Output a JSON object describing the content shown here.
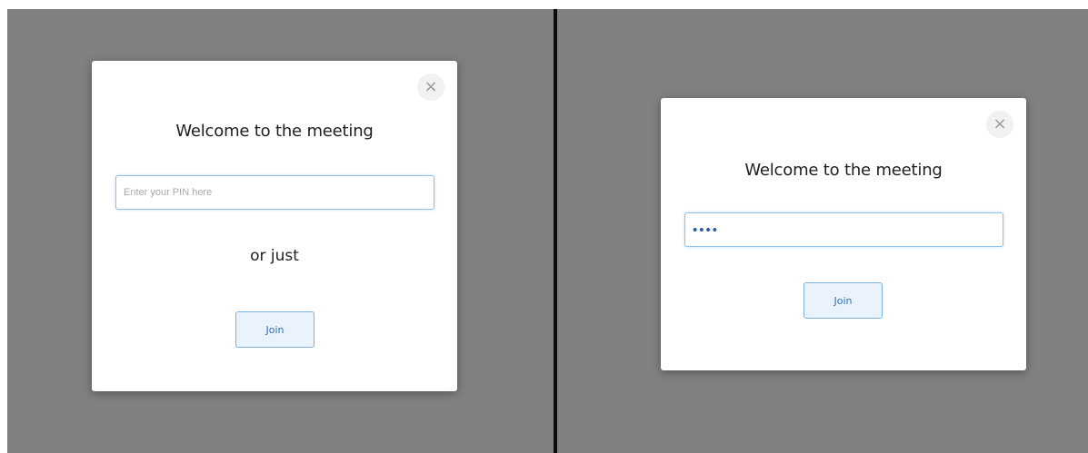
{
  "left_dialog": {
    "close_glyph": "×",
    "title": "Welcome to the meeting",
    "pin_input": {
      "placeholder": "Enter your PIN here",
      "value": ""
    },
    "or_text": "or just",
    "join_label": "Join"
  },
  "right_dialog": {
    "close_glyph": "×",
    "title": "Welcome to the meeting",
    "pin_input": {
      "value": "••••"
    },
    "join_label": "Join"
  },
  "colors": {
    "backdrop": "#808080",
    "divider": "#0b0b0b",
    "input_border": "#8fc3ea",
    "button_border": "#7eb2de",
    "button_bg": "#eaf3fb",
    "button_text": "#2a6fb7"
  }
}
